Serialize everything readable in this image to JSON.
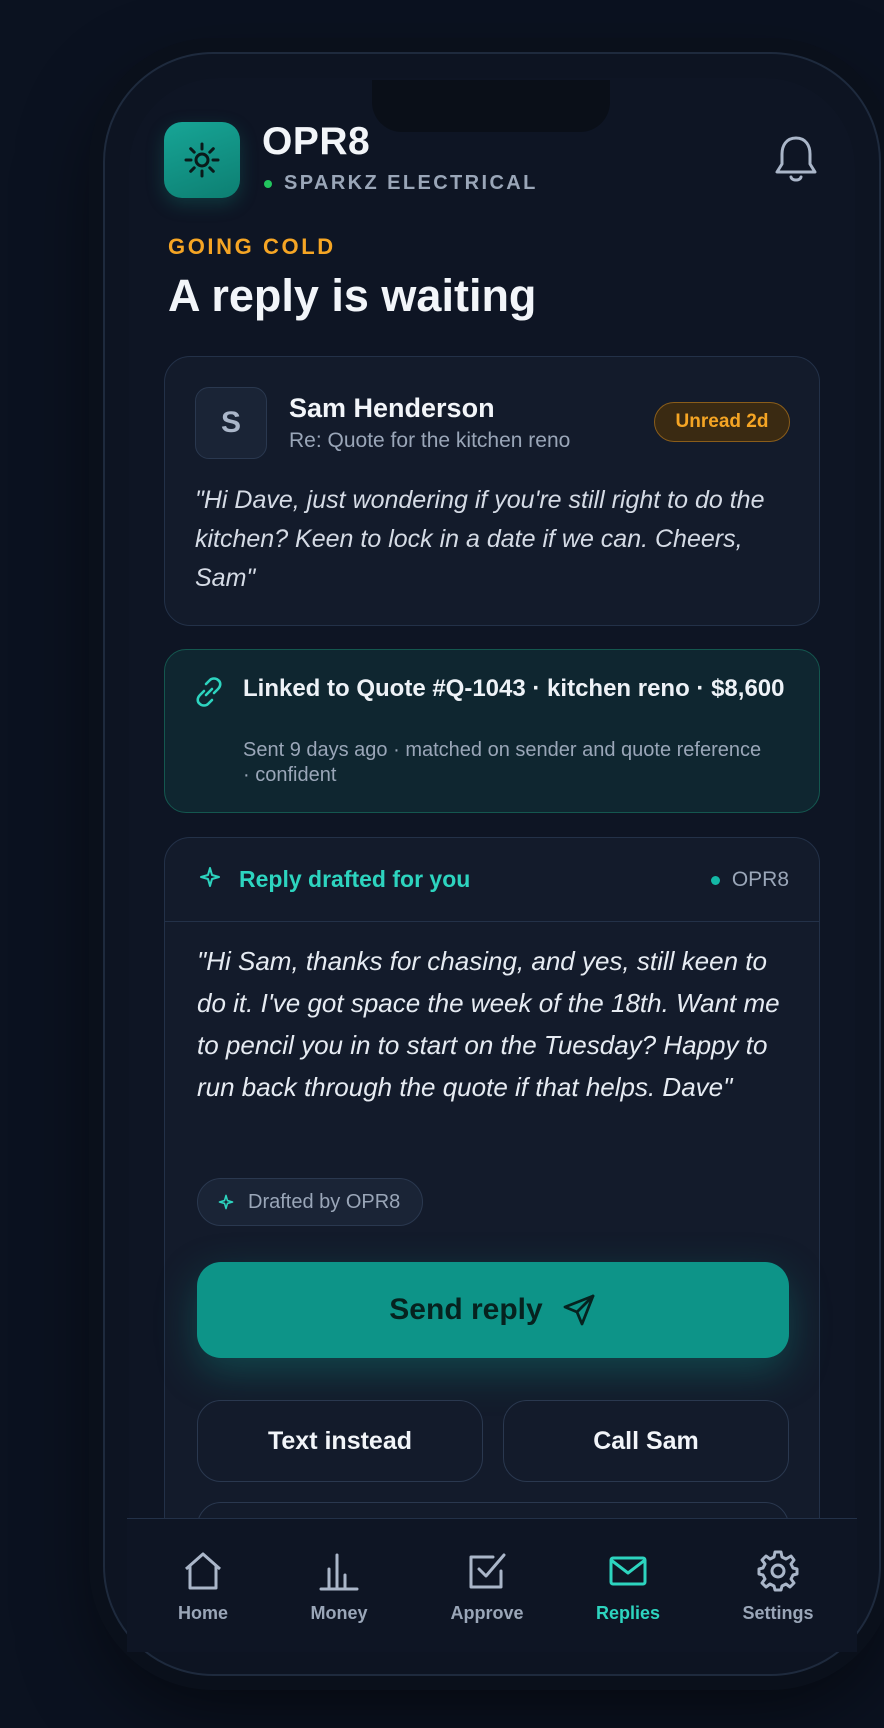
{
  "header": {
    "app_name": "OPR8",
    "company": "SPARKZ ELECTRICAL",
    "app_icon": "sun-icon",
    "notification_icon": "bell-icon"
  },
  "section": {
    "eyebrow": "GOING COLD",
    "title": "A reply is waiting"
  },
  "message": {
    "avatar_initial": "S",
    "sender": "Sam Henderson",
    "subject": "Re: Quote for the kitchen reno",
    "badge": "Unread 2d",
    "body": "\"Hi Dave, just wondering if you're still right to do the kitchen? Keen to lock in a date if we can. Cheers, Sam\""
  },
  "linked_quote": {
    "title": "Linked to Quote #Q-1043 · kitchen reno · $8,600",
    "meta": "Sent 9 days ago · matched on sender and quote reference · confident"
  },
  "draft": {
    "title": "Reply drafted for you",
    "source": "OPR8",
    "body": "\"Hi Sam, thanks for chasing, and yes, still keen to do it. I've got space the week of the 18th. Want me to pencil you in to start on the Tuesday? Happy to run back through the quote if that helps. Dave\"",
    "chip": "Drafted by OPR8",
    "send_label": "Send reply",
    "text_label": "Text instead",
    "call_label": "Call Sam"
  },
  "tabs": [
    {
      "label": "Home",
      "icon": "home-icon",
      "active": false
    },
    {
      "label": "Money",
      "icon": "bar-chart-icon",
      "active": false
    },
    {
      "label": "Approve",
      "icon": "checkbox-icon",
      "active": false
    },
    {
      "label": "Replies",
      "icon": "mail-icon",
      "active": true
    },
    {
      "label": "Settings",
      "icon": "gear-icon",
      "active": false
    }
  ],
  "colors": {
    "accent": "#2dd4bf",
    "primary_button": "#0d9488",
    "warning": "#f5a524",
    "background": "#0b1220"
  }
}
